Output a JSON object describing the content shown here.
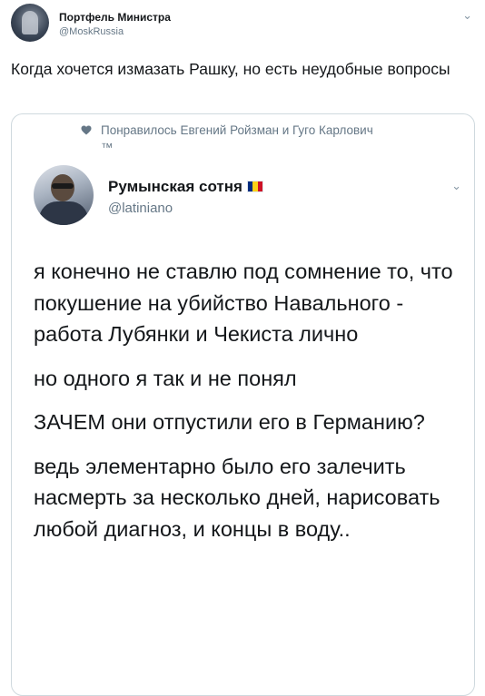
{
  "tweet": {
    "author_name": "Портфель Министра",
    "author_handle": "@MoskRussia",
    "text": "Когда хочется измазать Рашку, но есть неудобные вопросы"
  },
  "quoted": {
    "liked_by": "Понравилось Евгений Ройзман и Гуго Карлович ™",
    "author_name": "Румынская сотня",
    "author_handle": "@latiniano",
    "flag_colors": [
      "#002b7f",
      "#fcd116",
      "#ce1126"
    ],
    "paragraphs": [
      "я конечно не ставлю под сомнение то, что покушение на убийство Навального - работа Лубянки и Чекиста лично",
      "но одного я так и не понял",
      "ЗАЧЕМ они отпустили его в Германию?",
      "ведь элементарно было его залечить насмерть за несколько дней, нарисовать любой диагноз, и концы в воду.."
    ]
  },
  "icons": {
    "chevron": "chevron-down-icon",
    "heart": "heart-icon"
  },
  "colors": {
    "secondary_text": "#657786",
    "border": "#cfd9de",
    "primary_text": "#14171a"
  }
}
